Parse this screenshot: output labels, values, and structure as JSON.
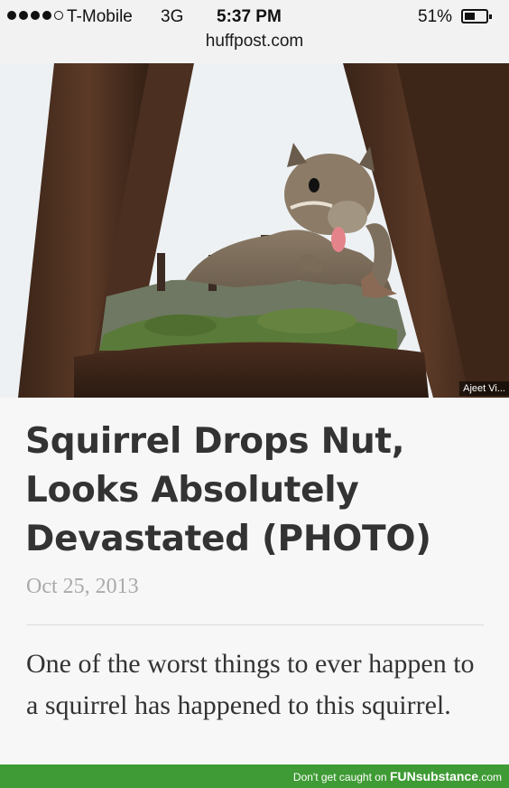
{
  "status_bar": {
    "carrier": "T-Mobile",
    "network": "3G",
    "time": "5:37 PM",
    "battery_percent": "51%",
    "battery_level": 0.51,
    "signal_bars_filled": 4,
    "signal_bars_total": 5
  },
  "browser": {
    "url": "huffpost.com"
  },
  "photo": {
    "credit": "Ajeet Vi..."
  },
  "article": {
    "headline": "Squirrel Drops Nut, Looks Absolutely Devastated (PHOTO)",
    "date": "Oct 25, 2013",
    "lede": "One of the worst things to ever happen to a squirrel has happened to this squirrel."
  },
  "footer": {
    "prefix": "Don't get caught on ",
    "brand_fun": "FUN",
    "brand_rest": "substance",
    "suffix": ".com",
    "color": "#3f9b35"
  }
}
